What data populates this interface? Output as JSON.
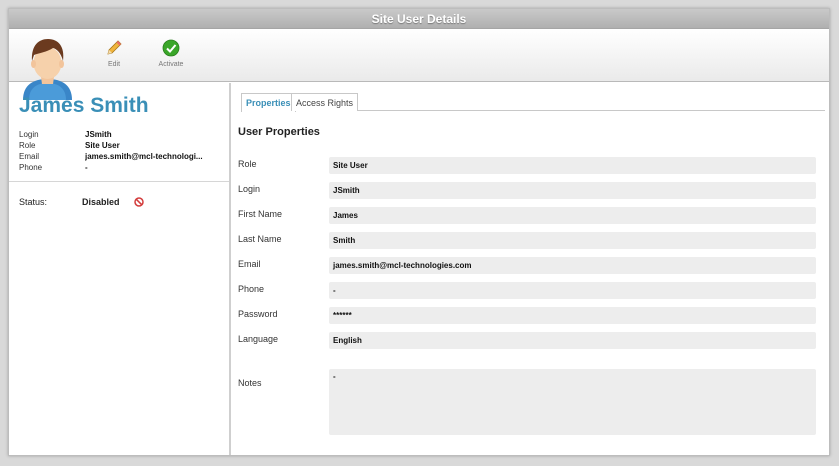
{
  "window": {
    "title": "Site User Details"
  },
  "toolbar": {
    "edit_label": "Edit",
    "activate_label": "Activate"
  },
  "user": {
    "name": "James Smith",
    "info": [
      {
        "label": "Login",
        "value": "JSmith"
      },
      {
        "label": "Role",
        "value": "Site User"
      },
      {
        "label": "Email",
        "value": "james.smith@mcl-technologi..."
      },
      {
        "label": "Phone",
        "value": "-"
      }
    ],
    "status_label": "Status:",
    "status_value": "Disabled"
  },
  "tabs": [
    {
      "label": "Properties",
      "active": true
    },
    {
      "label": "Access Rights",
      "active": false
    }
  ],
  "properties": {
    "section_title": "User Properties",
    "fields": [
      {
        "label": "Role",
        "value": "Site User"
      },
      {
        "label": "Login",
        "value": "JSmith"
      },
      {
        "label": "First Name",
        "value": "James"
      },
      {
        "label": "Last Name",
        "value": "Smith"
      },
      {
        "label": "Email",
        "value": "james.smith@mcl-technologies.com"
      },
      {
        "label": "Phone",
        "value": "-"
      },
      {
        "label": "Password",
        "value": "******"
      },
      {
        "label": "Language",
        "value": "English"
      }
    ],
    "notes_label": "Notes",
    "notes_value": "-"
  },
  "colors": {
    "accent": "#3a8fb7",
    "titlebar": "#b8b8b8",
    "field_bg": "#ededed",
    "activate_green": "#3aa629",
    "disabled_red": "#d23b3b"
  },
  "icons": {
    "avatar": "user-avatar-icon",
    "edit": "pencil-icon",
    "activate": "check-circle-icon",
    "status": "no-entry-icon"
  }
}
